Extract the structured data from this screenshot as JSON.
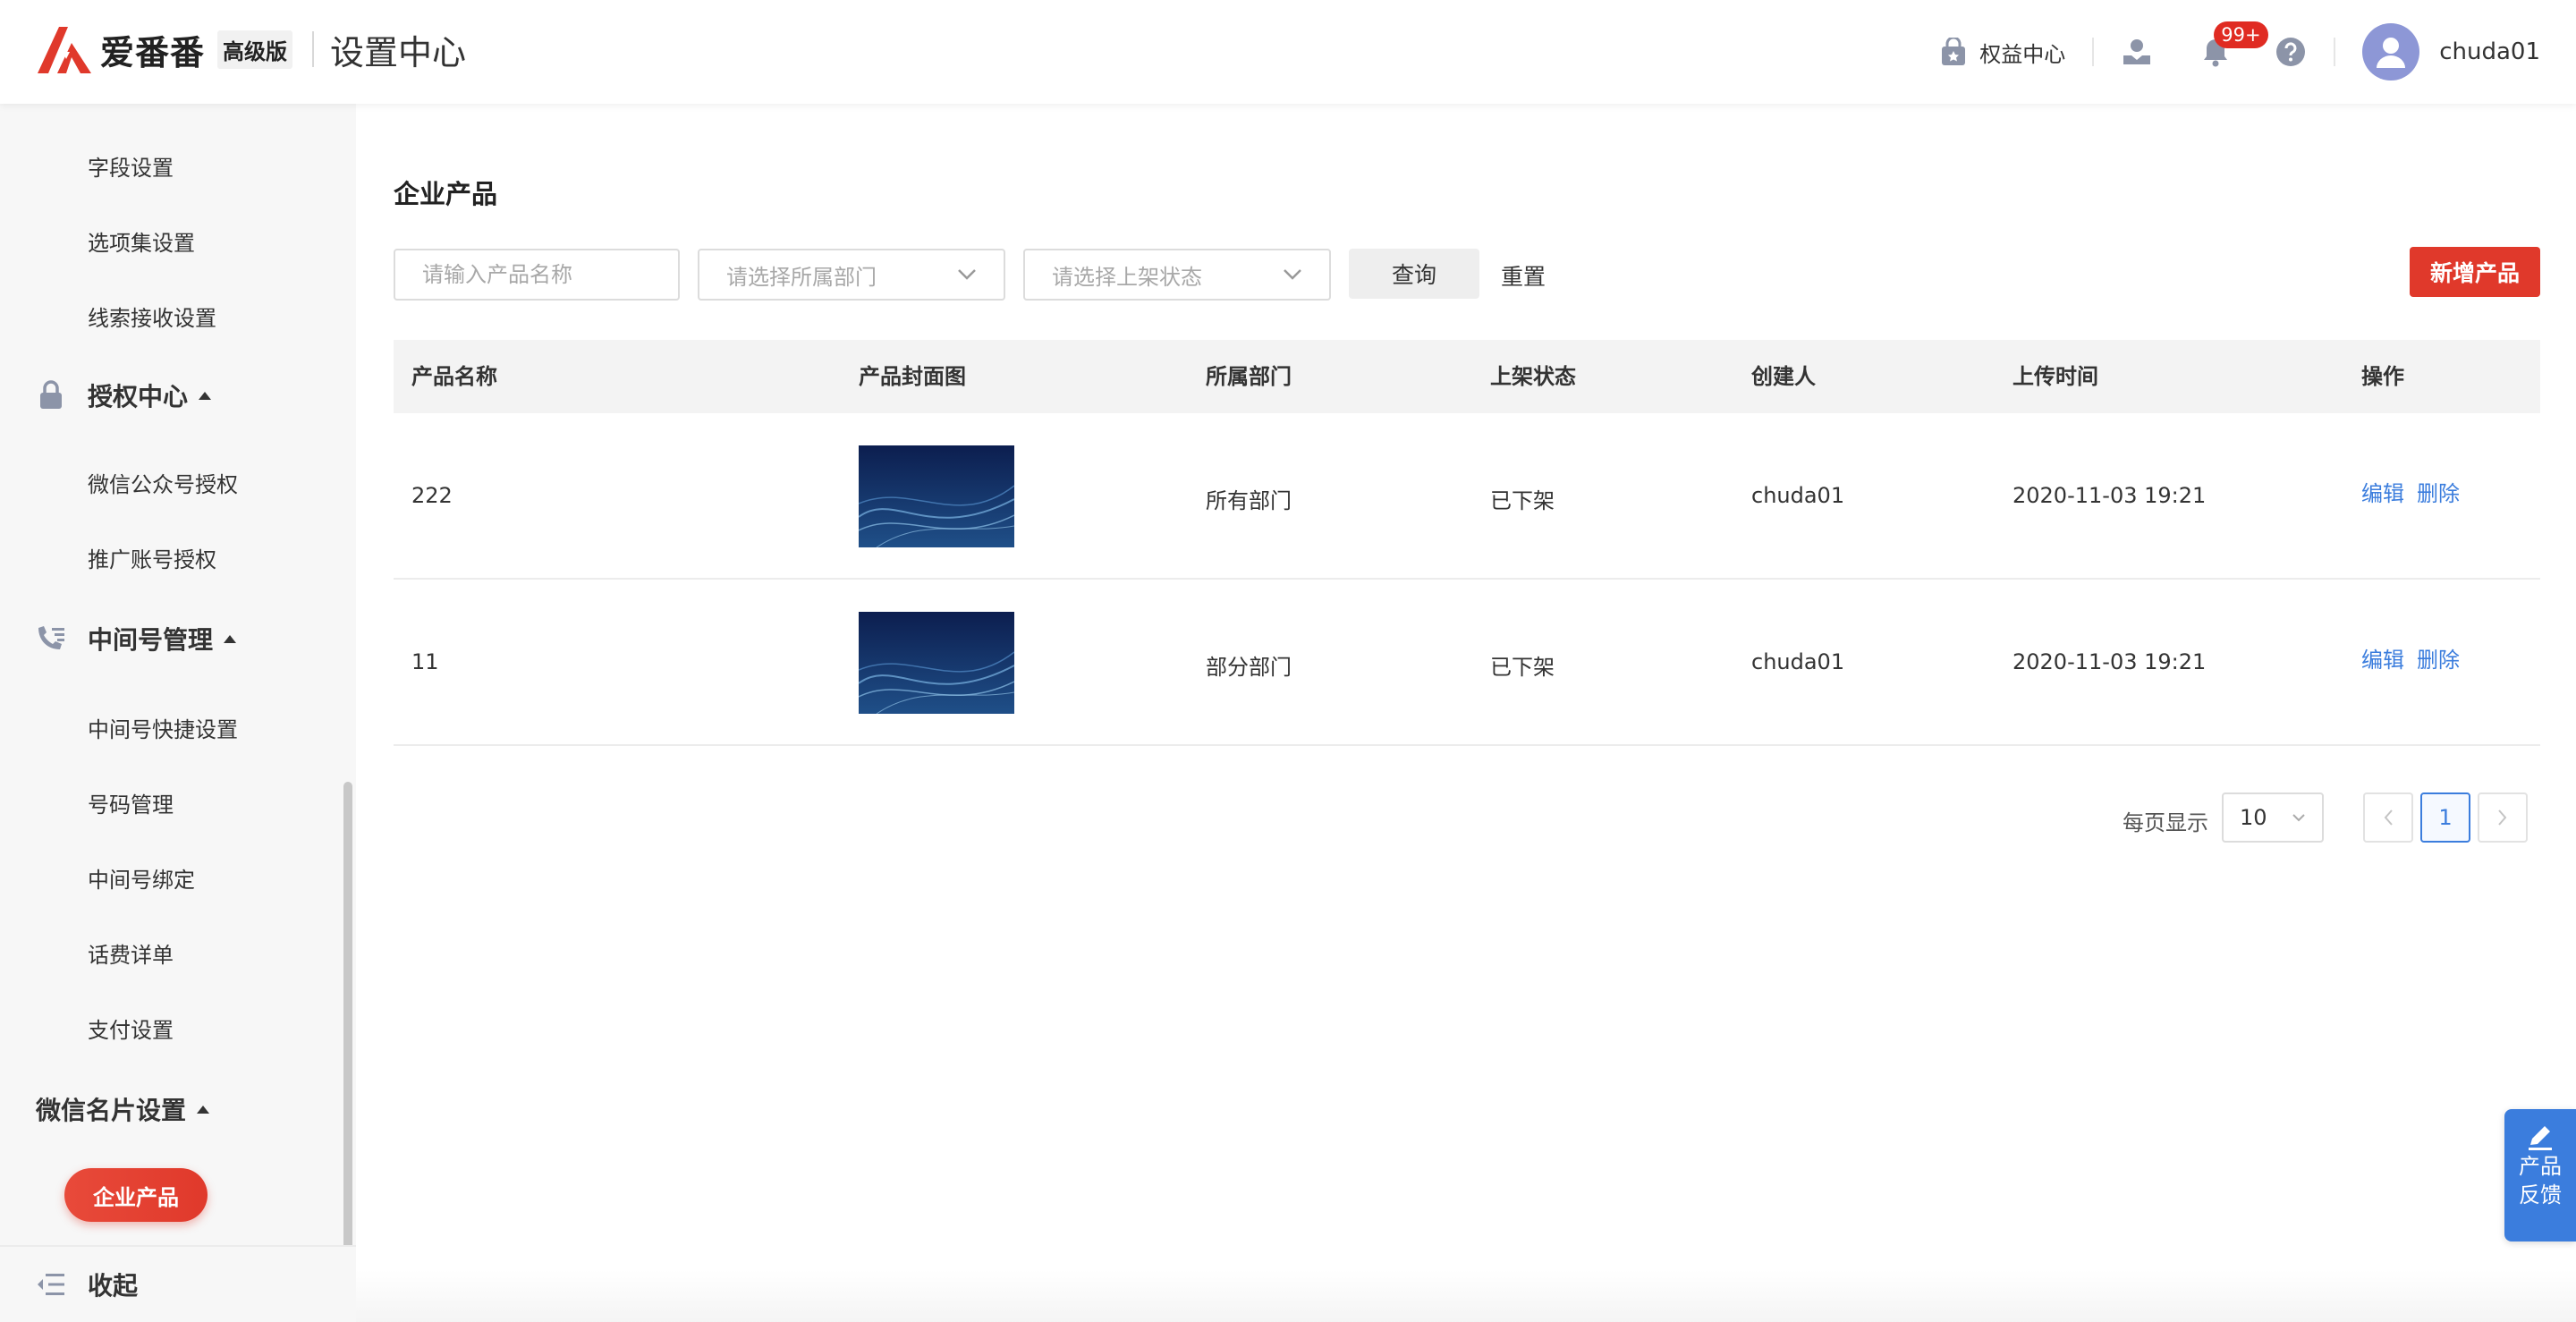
{
  "header": {
    "logo_text": "爱番番",
    "edition": "高级版",
    "title": "设置中心",
    "benefit_label": "权益中心",
    "notification_count": "99+",
    "username": "chuda01"
  },
  "sidebar": {
    "items_top": [
      "字段设置",
      "选项集设置",
      "线索接收设置"
    ],
    "group_auth": "授权中心",
    "auth_items": [
      "微信公众号授权",
      "推广账号授权"
    ],
    "group_virtual": "中间号管理",
    "virtual_items": [
      "中间号快捷设置",
      "号码管理",
      "中间号绑定",
      "话费详单",
      "支付设置"
    ],
    "group_wechat": "微信名片设置",
    "active_item": "企业产品",
    "collapse_label": "收起"
  },
  "main": {
    "title": "企业产品",
    "filters": {
      "name_placeholder": "请输入产品名称",
      "dept_placeholder": "请选择所属部门",
      "status_placeholder": "请选择上架状态"
    },
    "query_label": "查询",
    "reset_label": "重置",
    "add_label": "新增产品",
    "table": {
      "columns": [
        "产品名称",
        "产品封面图",
        "所属部门",
        "上架状态",
        "创建人",
        "上传时间",
        "操作"
      ],
      "rows": [
        {
          "name": "222",
          "dept": "所有部门",
          "status": "已下架",
          "creator": "chuda01",
          "time": "2020-11-03 19:21"
        },
        {
          "name": "11",
          "dept": "部分部门",
          "status": "已下架",
          "creator": "chuda01",
          "time": "2020-11-03 19:21"
        }
      ],
      "edit_label": "编辑",
      "delete_label": "删除"
    },
    "pagination": {
      "per_page_label": "每页显示",
      "per_page_value": "10",
      "current_page": "1"
    }
  },
  "feedback": {
    "line1": "产品",
    "line2": "反馈"
  },
  "colors": {
    "brand_red": "#e0392b",
    "link_blue": "#3b7ddd"
  }
}
